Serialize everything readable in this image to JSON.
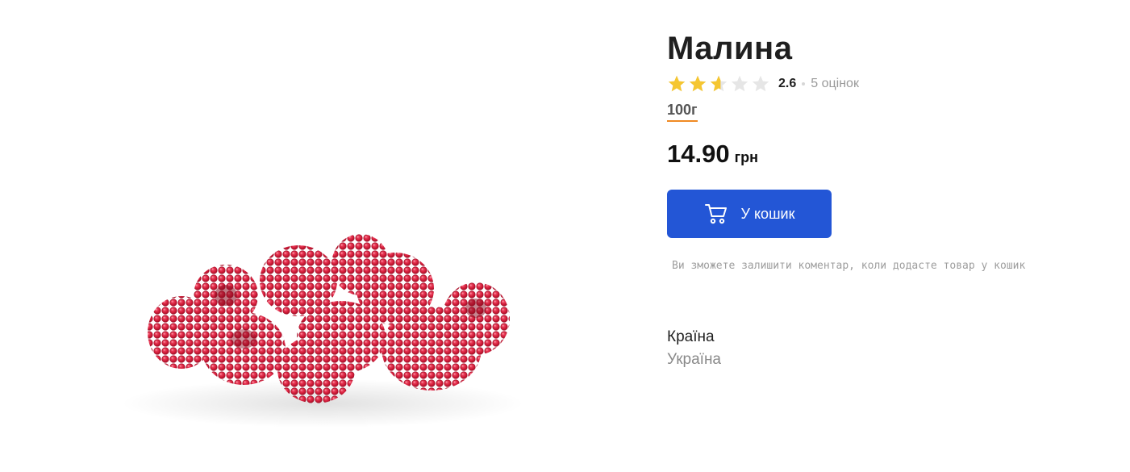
{
  "product": {
    "title": "Малина",
    "image_alt": "raspberries",
    "rating": {
      "value": "2.6",
      "stars": 2.6,
      "max_stars": 5,
      "count_text": "5 оцінок",
      "star_color": "#f5c631",
      "star_empty_color": "#e6e6e6"
    },
    "weight": "100г",
    "price": {
      "value": "14.90",
      "currency": "грн"
    },
    "cart_button": {
      "label": "У кошик",
      "icon": "cart-icon",
      "color": "#2356d6"
    },
    "comment_hint": "Ви зможете залишити коментар, коли додасте товар у кошик",
    "attributes": [
      {
        "label": "Країна",
        "value": "Україна"
      }
    ]
  }
}
